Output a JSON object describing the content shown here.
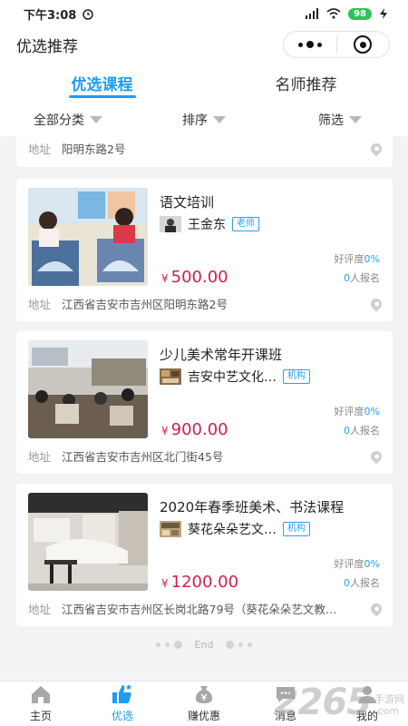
{
  "status_bar": {
    "time": "下午3:08",
    "battery": "98"
  },
  "header": {
    "title": "优选推荐"
  },
  "tabs": [
    {
      "label": "优选课程",
      "active": true
    },
    {
      "label": "名师推荐",
      "active": false
    }
  ],
  "filters": [
    {
      "label": "全部分类"
    },
    {
      "label": "排序"
    },
    {
      "label": "筛选"
    }
  ],
  "partial_card": {
    "addr_label": "地址",
    "address": "阳明东路2号"
  },
  "courses": [
    {
      "title": "语文培训",
      "teacher": "王金东",
      "tag": "老师",
      "rating_label": "好评度",
      "rating": "0%",
      "currency": "¥",
      "price": "500.00",
      "enroll_count": "0",
      "enroll_suffix": "人报名",
      "addr_label": "地址",
      "address": "江西省吉安市吉州区阳明东路2号"
    },
    {
      "title": "少儿美术常年开课班",
      "teacher": "吉安中艺文化…",
      "tag": "机构",
      "rating_label": "好评度",
      "rating": "0%",
      "currency": "¥",
      "price": "900.00",
      "enroll_count": "0",
      "enroll_suffix": "人报名",
      "addr_label": "地址",
      "address": "江西省吉安市吉州区北门街45号"
    },
    {
      "title": "2020年春季班美术、书法课程",
      "teacher": "葵花朵朵艺文…",
      "tag": "机构",
      "rating_label": "好评度",
      "rating": "0%",
      "currency": "¥",
      "price": "1200.00",
      "enroll_count": "0",
      "enroll_suffix": "人报名",
      "addr_label": "地址",
      "address": "江西省吉安市吉州区长岗北路79号（葵花朵朵艺文教…"
    }
  ],
  "list_end": "End",
  "tabbar": [
    {
      "label": "主页",
      "icon": "home-icon"
    },
    {
      "label": "优选",
      "icon": "thumbs-up-icon",
      "active": true
    },
    {
      "label": "赚优惠",
      "icon": "money-bag-icon"
    },
    {
      "label": "消息",
      "icon": "message-icon"
    },
    {
      "label": "我的",
      "icon": "user-icon"
    }
  ],
  "watermark": {
    "number": "2265",
    "domain": ".com",
    "text": "手游网"
  },
  "colors": {
    "accent": "#1e9cf2",
    "price": "#d11f4f",
    "background": "#f2f3f5"
  }
}
